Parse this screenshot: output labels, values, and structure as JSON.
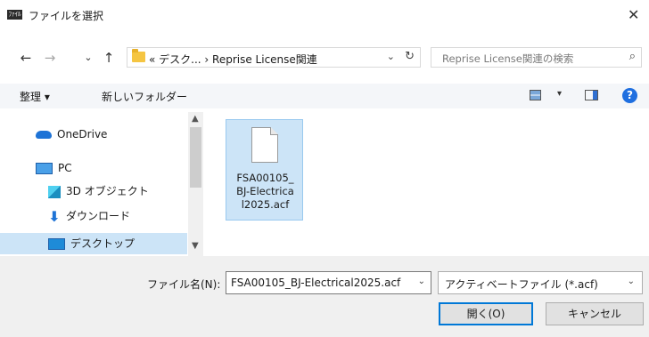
{
  "window": {
    "title": "ファイルを選択",
    "title_icon_text": "ﾌｧｲﾙ",
    "close_glyph": "✕"
  },
  "nav": {
    "back_glyph": "←",
    "forward_glyph": "→",
    "recent_glyph": "⌄",
    "up_glyph": "↑",
    "address_path": "« デスク... › Reprise License関連",
    "address_chevron": "⌄",
    "refresh_glyph": "↻",
    "search_placeholder": "Reprise License関連の検索",
    "search_glyph": "⌕"
  },
  "toolbar": {
    "organize_label": "整理 ▾",
    "new_folder_label": "新しいフォルダー",
    "view_dropdown_glyph": "▾",
    "help_glyph": "?"
  },
  "sidebar": {
    "items": [
      {
        "label": "OneDrive",
        "icon": "onedrive-cloud-icon"
      },
      {
        "label": "PC",
        "icon": "pc-monitor-icon"
      },
      {
        "label": "3D オブジェクト",
        "icon": "3d-objects-icon"
      },
      {
        "label": "ダウンロード",
        "icon": "download-arrow-icon"
      },
      {
        "label": "デスクトップ",
        "icon": "desktop-icon",
        "selected": true
      }
    ],
    "scroll_up_glyph": "▲",
    "scroll_down_glyph": "▼"
  },
  "files": [
    {
      "name": "FSA00105_BJ-Electrical2025.acf",
      "display_lines": "FSA00105_ BJ-Electrica l2025.acf",
      "selected": true,
      "icon": "generic-file-icon"
    }
  ],
  "footer": {
    "filename_label": "ファイル名(N):",
    "filename_value": "FSA00105_BJ-Electrical2025.acf",
    "filename_chevron": "⌄",
    "filetype_value": "アクティベートファイル (*.acf)",
    "filetype_chevron": "⌄",
    "open_label": "開く(O)",
    "cancel_label": "キャンセル"
  },
  "colors": {
    "selection": "#cce4f7",
    "accent": "#0078d7",
    "help": "#1f6fe0"
  }
}
